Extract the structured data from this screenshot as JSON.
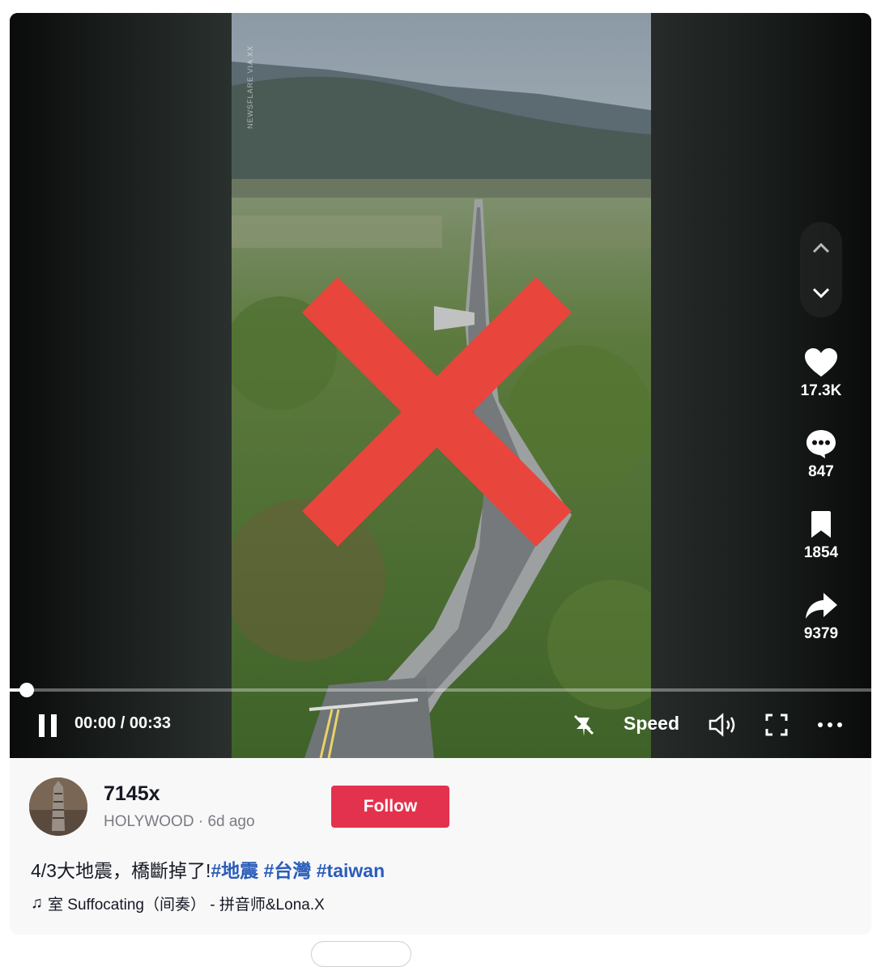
{
  "video": {
    "watermark": "NEWSFLARE VIA XX",
    "current_time": "00:00",
    "duration": "00:33",
    "progress_fraction": 0.02,
    "speed_label": "Speed",
    "time_separator": " / "
  },
  "actions": {
    "likes": "17.3K",
    "comments": "847",
    "bookmarks": "1854",
    "shares": "9379"
  },
  "author": {
    "username": "7145x",
    "nickname": "HOLYWOOD",
    "posted": "6d ago",
    "meta_separator": " · "
  },
  "follow_label": "Follow",
  "caption": {
    "text": "4/3大地震，橋斷掉了!",
    "tags": [
      "#地震",
      "#台灣",
      "#taiwan"
    ]
  },
  "music": {
    "title": "室 Suffocating（间奏） - 拼音师&Lona.X"
  },
  "colors": {
    "follow_bg": "#e3324d",
    "hashtag": "#2b5db9",
    "x_mark": "#e8453c"
  },
  "icons": {
    "pause": "pause-icon",
    "volume": "volume-icon",
    "fullscreen": "fullscreen-icon",
    "more": "more-icon",
    "like": "heart-icon",
    "comment": "comment-icon",
    "bookmark": "bookmark-icon",
    "share": "share-icon"
  }
}
